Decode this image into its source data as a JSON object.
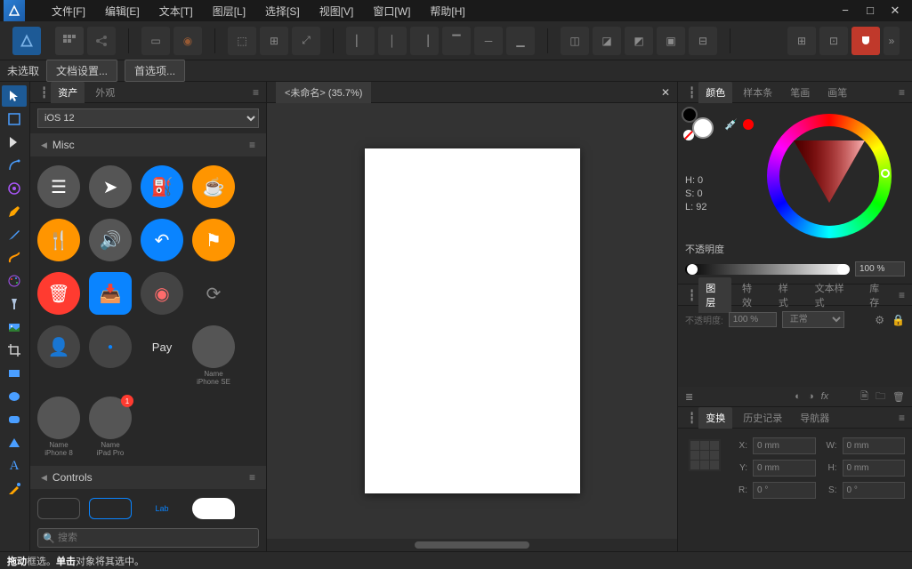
{
  "menu": {
    "file": "文件[F]",
    "edit": "编辑[E]",
    "text": "文本[T]",
    "layer": "图层[L]",
    "select": "选择[S]",
    "view": "视图[V]",
    "window": "窗口[W]",
    "help": "帮助[H]"
  },
  "context": {
    "unselected": "未选取",
    "doc_settings": "文档设置...",
    "preferences": "首选项..."
  },
  "assets": {
    "tab_assets": "资产",
    "tab_appearance": "外观",
    "preset": "iOS 12",
    "cat_misc": "Misc",
    "cat_controls": "Controls",
    "control_label": "Lab",
    "device_label_1": "Name\niPhone SE",
    "device_label_2": "Name\niPhone 8",
    "device_label_3": "Name\niPad Pro",
    "search_placeholder": "搜索"
  },
  "document": {
    "tab_title": "<未命名> (35.7%)"
  },
  "color_panel": {
    "tab_color": "颜色",
    "tab_swatches": "样本条",
    "tab_stroke": "笔画",
    "tab_brush": "画笔",
    "h": "H: 0",
    "s": "S: 0",
    "l": "L: 92",
    "opacity_label": "不透明度",
    "opacity_value": "100 %"
  },
  "layers_panel": {
    "tab_layers": "图层",
    "tab_effects": "特效",
    "tab_styles": "样式",
    "tab_text_styles": "文本样式",
    "tab_library": "库存",
    "opacity_label": "不透明度:",
    "opacity_value": "100 %",
    "blend_mode": "正常"
  },
  "transform_panel": {
    "tab_transform": "变换",
    "tab_history": "历史记录",
    "tab_navigator": "导航器",
    "x_label": "X:",
    "y_label": "Y:",
    "w_label": "W:",
    "h_label": "H:",
    "r_label": "R:",
    "s_label": "S:",
    "zero_mm": "0 mm",
    "zero_deg": "0 °"
  },
  "status": {
    "drag": "拖动",
    "drag_desc": " 框选。",
    "click": "单击",
    "click_desc": " 对象将其选中。"
  }
}
